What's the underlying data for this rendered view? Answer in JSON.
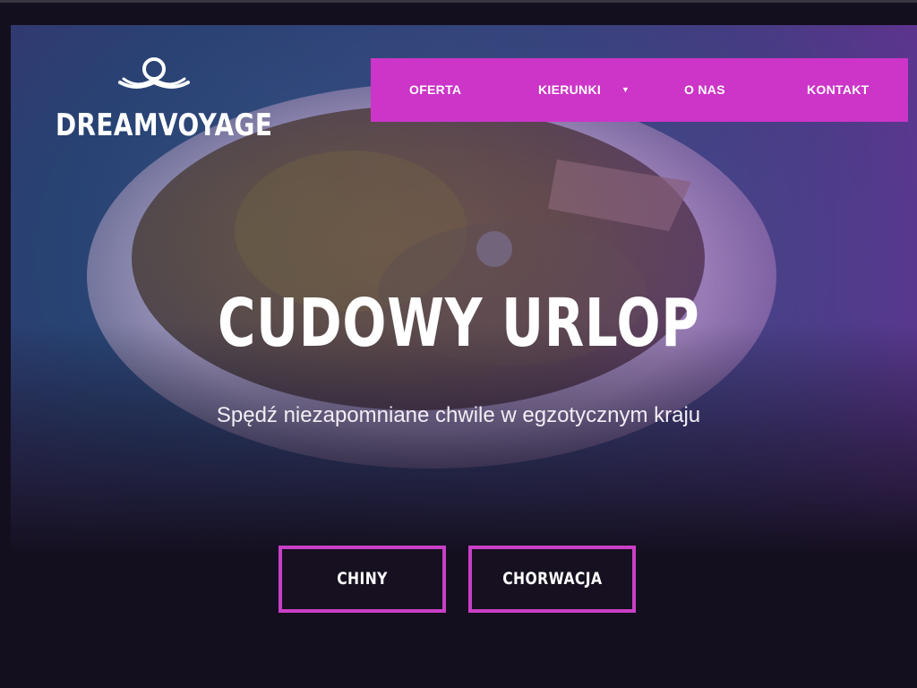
{
  "brand": {
    "name": "DREAMVOYAGE",
    "logo_icon": "wave-loop-icon"
  },
  "nav": {
    "items": [
      {
        "label": "OFERTA",
        "has_dropdown": false
      },
      {
        "label": "KIERUNKI",
        "has_dropdown": true,
        "dropdown_icon": "caret-down-icon",
        "dropdown_glyph": "▼"
      },
      {
        "label": "O NAS",
        "has_dropdown": false
      },
      {
        "label": "KONTAKT",
        "has_dropdown": false
      }
    ]
  },
  "hero": {
    "title": "CUDOWY URLOP",
    "subtitle": "Spędź niezapomniane chwile w egzotycznym kraju",
    "background_image": "aerial-island-photo"
  },
  "cta": {
    "buttons": [
      {
        "label": "CHINY"
      },
      {
        "label": "CHORWACJA"
      }
    ]
  },
  "colors": {
    "accent": "#cc35c8",
    "button_border": "#c93fc7",
    "page_background": "#140f1e",
    "text": "#ffffff"
  }
}
